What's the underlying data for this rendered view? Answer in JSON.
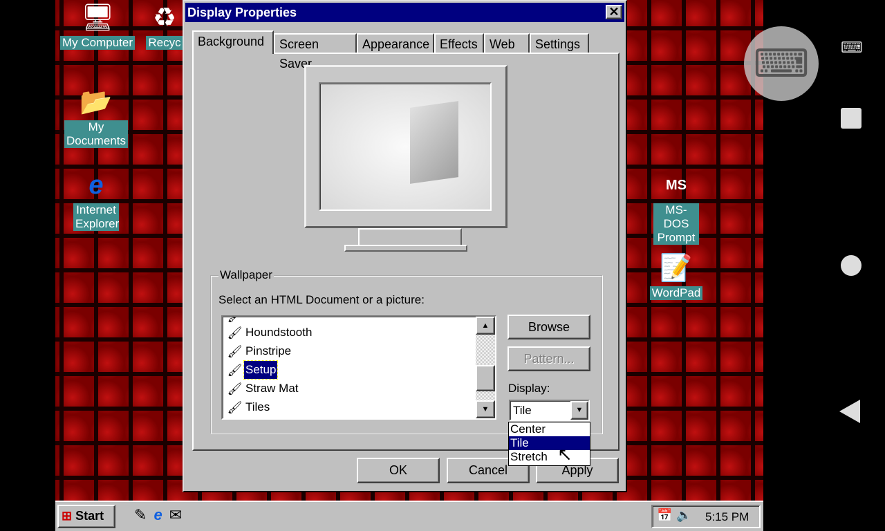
{
  "desktop": {
    "icons": [
      {
        "label": "My Computer",
        "icon": "computer-icon"
      },
      {
        "label": "Recyc",
        "icon": "recycle-bin-icon"
      },
      {
        "label": "My Documents",
        "icon": "folder-icon"
      },
      {
        "label": "Internet Explorer",
        "icon": "ie-icon"
      },
      {
        "label": "MS-DOS Prompt",
        "icon": "msdos-icon"
      },
      {
        "label": "WordPad",
        "icon": "wordpad-icon"
      }
    ]
  },
  "dialog": {
    "title": "Display Properties",
    "tabs": [
      {
        "label": "Background",
        "active": true
      },
      {
        "label": "Screen Saver"
      },
      {
        "label": "Appearance"
      },
      {
        "label": "Effects"
      },
      {
        "label": "Web"
      },
      {
        "label": "Settings"
      }
    ],
    "wallpaper": {
      "group_label": "Wallpaper",
      "prompt": "Select an HTML Document or a picture:",
      "items": [
        "Houndstooth",
        "Pinstripe",
        "Setup",
        "Straw Mat",
        "Tiles"
      ],
      "selected": "Setup",
      "browse": "Browse",
      "pattern": "Pattern...",
      "display_label": "Display:",
      "display_value": "Tile",
      "display_options": [
        "Center",
        "Tile",
        "Stretch"
      ]
    },
    "buttons": {
      "ok": "OK",
      "cancel": "Cancel",
      "apply": "Apply"
    }
  },
  "taskbar": {
    "start": "Start",
    "clock": "5:15 PM"
  },
  "colors": {
    "titlebar": "#000080",
    "face": "#c0c0c0",
    "desktop_label": "#3f8f8f"
  }
}
